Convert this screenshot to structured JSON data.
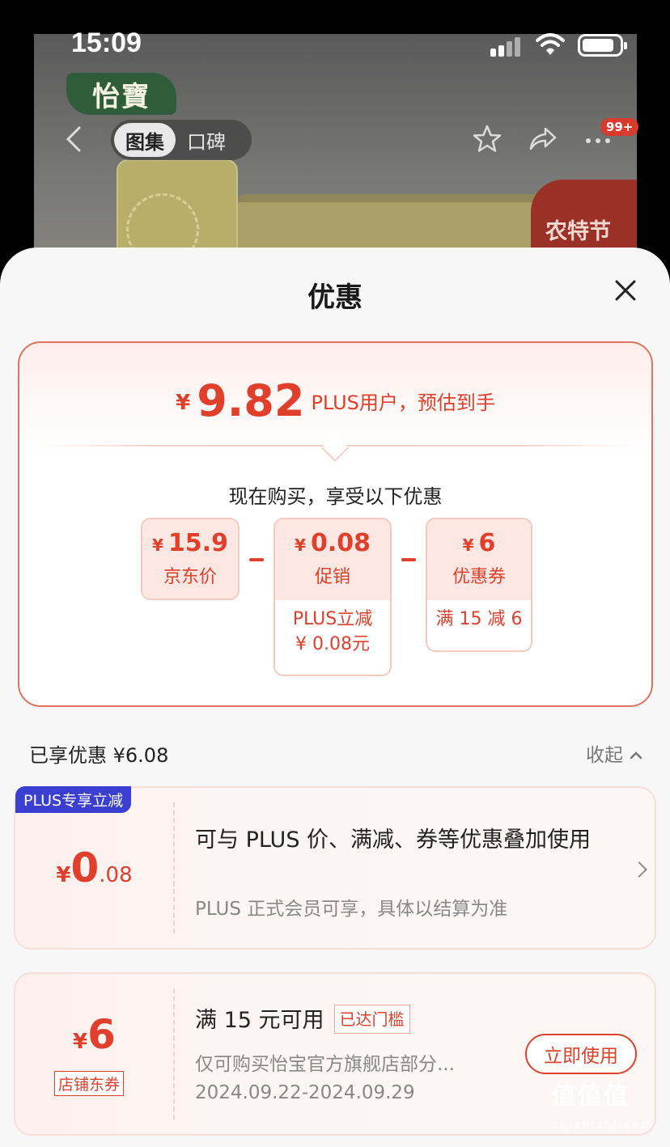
{
  "status_bar": {
    "time": "15:09"
  },
  "background": {
    "logo_text": "怡寶",
    "promo_ribbon": "农特节",
    "tabs": [
      {
        "label": "图集",
        "active": true
      },
      {
        "label": "口碑",
        "active": false
      }
    ],
    "more_badge": "99+"
  },
  "sheet": {
    "title": "优惠",
    "estimate": {
      "currency": "¥",
      "price": "9.82",
      "description": "PLUS用户，预估到手"
    },
    "buy_hint": "现在购买，享受以下优惠",
    "breakdown": [
      {
        "currency": "¥",
        "amount": "15.9",
        "label": "京东价"
      },
      {
        "currency": "¥",
        "amount": "0.08",
        "label": "促销",
        "sub_line1": "PLUS立减",
        "sub_line2": "¥ 0.08元"
      },
      {
        "currency": "¥",
        "amount": "6",
        "label": "优惠券",
        "sub_line1": "满 15 减 6"
      }
    ],
    "enjoyed": "已享优惠 ¥6.08",
    "collapse_label": "收起",
    "coupons": [
      {
        "tag": "PLUS专享立减",
        "currency": "¥",
        "amount_int": "0",
        "amount_dec": ".08",
        "title": "可与 PLUS 价、满减、券等优惠叠加使用",
        "desc": "PLUS 正式会员可享，具体以结算为准"
      },
      {
        "currency": "¥",
        "amount_int": "6",
        "type_tag": "店铺东券",
        "title": "满 15 元可用",
        "status_tag": "已达门槛",
        "desc": "仅可购买怡宝官方旗舰店部分...",
        "validity": "2024.09.22-2024.09.29",
        "action": "立即使用"
      }
    ]
  },
  "watermark": {
    "main": "值值值",
    "sub": "zhizhizhi.com"
  },
  "colors": {
    "accent": "#e0402b",
    "plus_tag": "#3a3fd1",
    "card_border": "#e2735f"
  }
}
